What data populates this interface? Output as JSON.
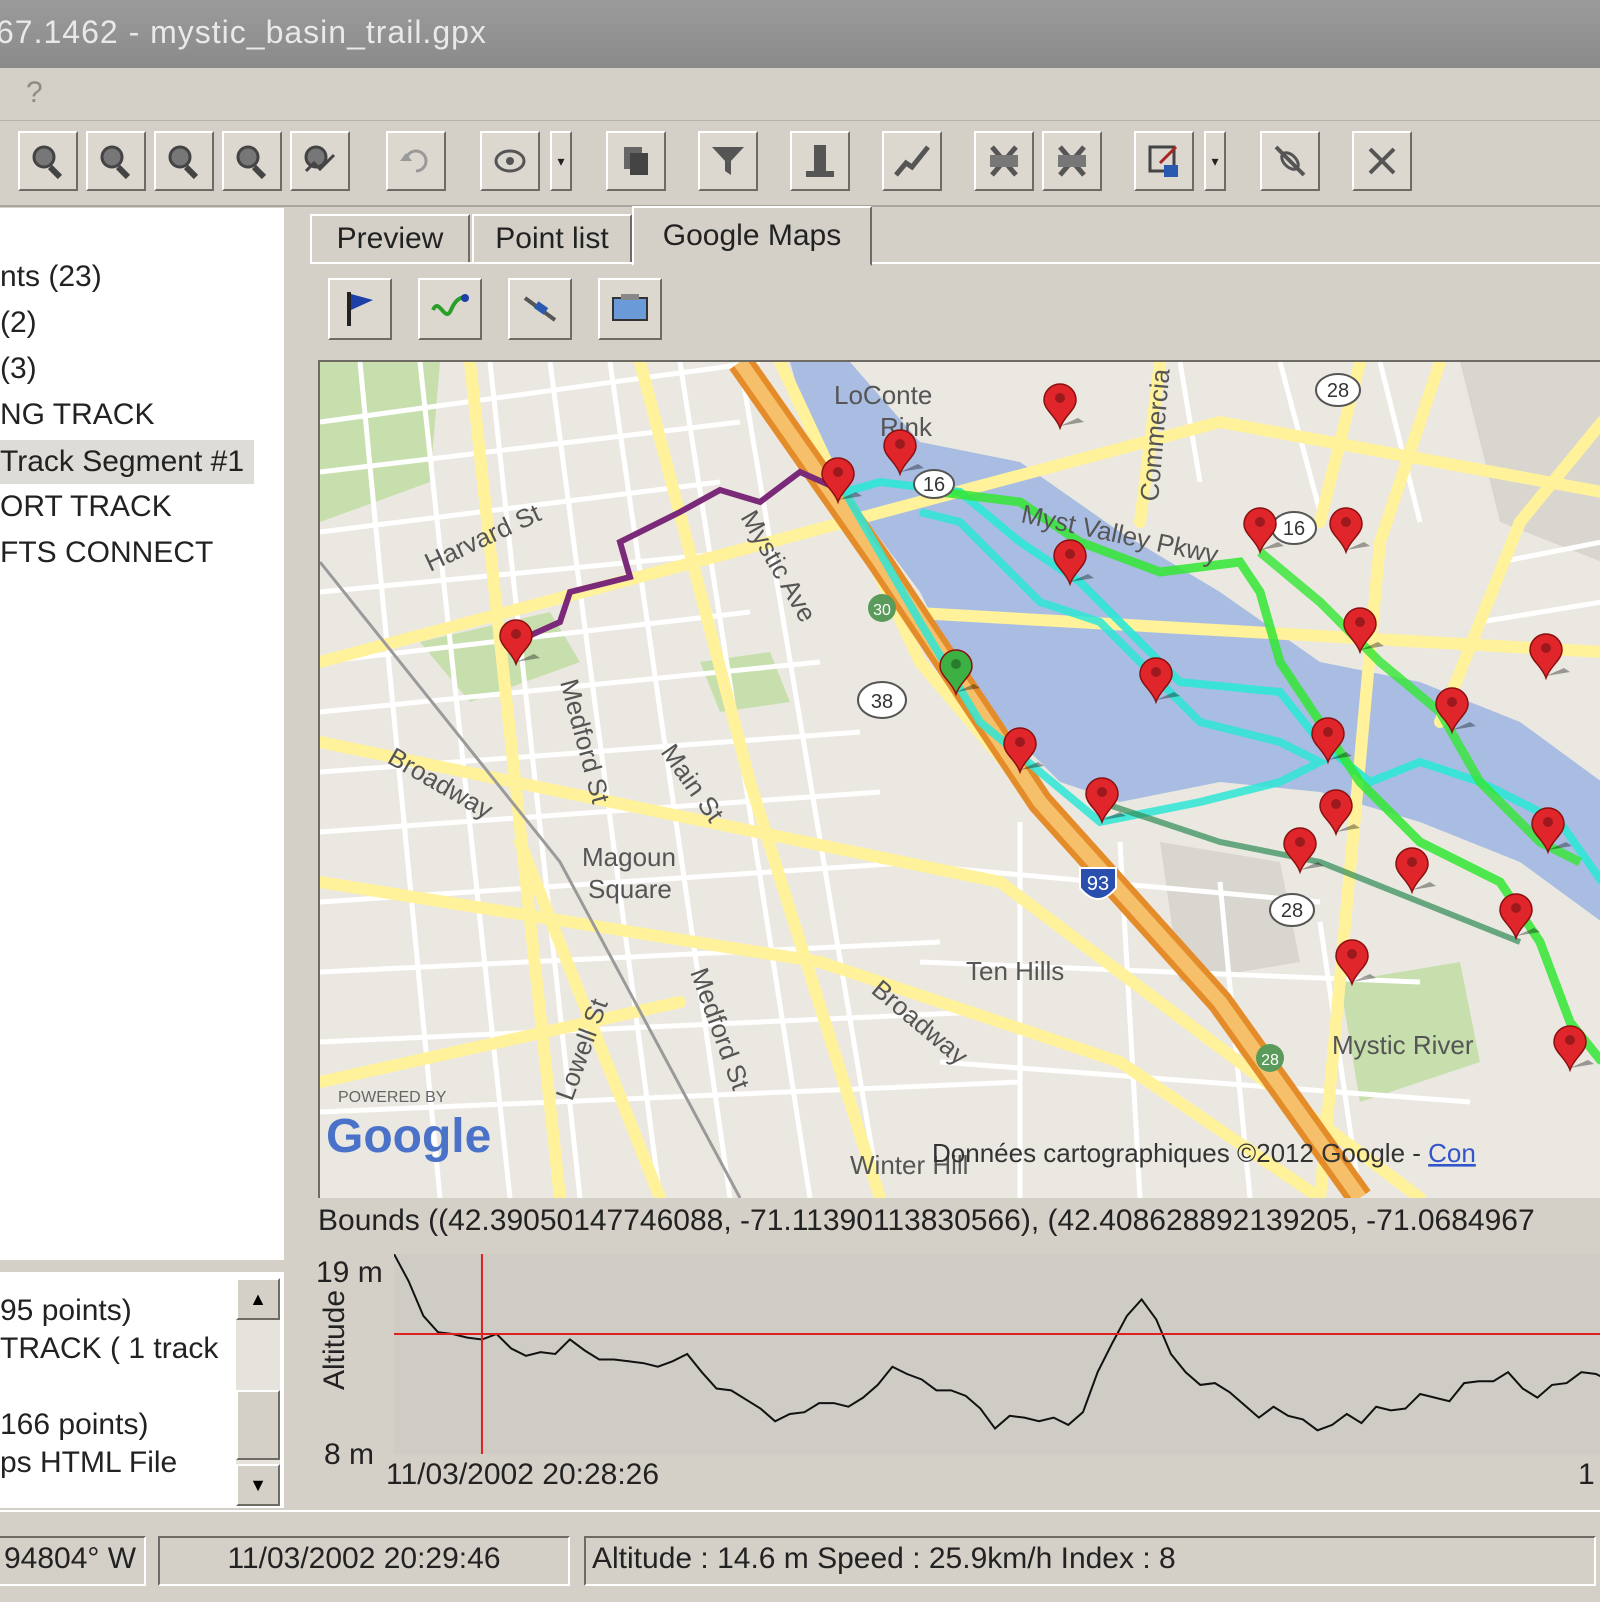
{
  "window": {
    "title": "67.1462 - mystic_basin_trail.gpx"
  },
  "menu": {
    "help_label": "?"
  },
  "toolbar": {
    "buttons": [
      "zoom-in-icon",
      "zoom-out-icon",
      "zoom-fit-icon",
      "zoom-selection-icon",
      "zoom-track-icon",
      "undo-icon",
      "rotate-icon",
      "copy-icon",
      "filter-icon",
      "split-icon",
      "merge-icon",
      "cut-icon",
      "cut-alt-icon",
      "export-icon",
      "link-icon",
      "close-icon"
    ]
  },
  "tree": {
    "items": [
      {
        "label": "nts (23)"
      },
      {
        "label": "(2)"
      },
      {
        "label": "(3)"
      },
      {
        "label": "NG TRACK"
      },
      {
        "label": " Track Segment #1"
      },
      {
        "label": "ORT TRACK"
      },
      {
        "label": "FTS CONNECT"
      }
    ]
  },
  "list": {
    "items": [
      {
        "label": "95 points)"
      },
      {
        "label": "TRACK ( 1 track"
      },
      {
        "label": "166 points)"
      },
      {
        "label": "ps HTML File"
      }
    ]
  },
  "tabs": [
    {
      "label": "Preview"
    },
    {
      "label": "Point list"
    },
    {
      "label": "Google Maps"
    }
  ],
  "map_toolbar": {
    "buttons": [
      "flag-icon",
      "track-icon",
      "route-icon",
      "screen-icon"
    ]
  },
  "map": {
    "labels": {
      "harvard": "Harvard St",
      "mystic_ave": "Mystic Ave",
      "loconte": "LoConte",
      "rink": "Rink",
      "commercial": "Commercia",
      "mystic_valley": "Myst Valley Pkwy",
      "broadway1": "Broadway",
      "broadway2": "Broadway",
      "medford1": "Medford St",
      "medford2": "Medford St",
      "main": "Main St",
      "magoun1": "Magoun",
      "magoun2": "Square",
      "ten_hills": "Ten Hills",
      "lowell": "Lowell St",
      "mystic_river": "Mystic River",
      "winter_hill": "Winter Hill",
      "shield_28a": "28",
      "shield_28b": "28",
      "shield_38": "38",
      "shield_16a": "16",
      "shield_16b": "16",
      "shield_93": "93",
      "shield_30": "30",
      "shield_28c": "28",
      "powered": "POWERED BY",
      "google": "Google",
      "copyright": "Données cartographiques ©2012 Google - ",
      "copyright_link": "Con"
    },
    "colors": {
      "water": "#a9bde3",
      "park": "#c6dfac",
      "road": "#fff6a8",
      "highway": "#f2a94e",
      "track_purple": "#7a2a78",
      "track_cyan": "#2ee6d6",
      "track_green": "#33e633",
      "marker_red": "#e0262a",
      "marker_green": "#3cb043"
    }
  },
  "bounds_text": "Bounds ((42.39050147746088, -71.11390113830566), (42.408628892139205, -71.0684967",
  "elevation": {
    "max_label": "19 m",
    "min_label": "8 m",
    "axis_label": "Altitude",
    "start_time": "11/03/2002 20:28:26",
    "end_time": "1",
    "profile": [
      19,
      17.5,
      15.6,
      14.7,
      14.6,
      14.4,
      14.3,
      14.6,
      13.8,
      13.4,
      13.6,
      13.5,
      14.3,
      13.7,
      13.2,
      13.2,
      13.1,
      13.0,
      12.8,
      13.1,
      13.5,
      12.5,
      11.6,
      11.5,
      11.0,
      10.5,
      9.8,
      10.2,
      10.3,
      10.8,
      10.8,
      10.6,
      11.1,
      11.8,
      12.8,
      12.4,
      12.1,
      11.5,
      11.5,
      11.2,
      10.5,
      9.4,
      10.1,
      10.0,
      9.8,
      10.0,
      9.6,
      10.3,
      12.5,
      14.1,
      15.6,
      16.5,
      15.4,
      13.5,
      12.5,
      11.8,
      11.9,
      11.4,
      10.7,
      10.0,
      10.6,
      10.1,
      9.9,
      9.3,
      9.6,
      10.2,
      9.7,
      10.6,
      10.4,
      10.5,
      11.3,
      11.1,
      10.9,
      11.9,
      12.0,
      12.0,
      12.5,
      11.6,
      11.1,
      11.8,
      11.9,
      12.5,
      12.4,
      12.0,
      12.6,
      11.7
    ],
    "marker_altitude": 14.6,
    "colors": {
      "line": "#111111",
      "marker": "#e02020",
      "plot_bg": "#cfccc5"
    }
  },
  "status": {
    "coords": "94804° W",
    "time": "11/03/2002 20:29:46",
    "info": "Altitude : 14.6 m  Speed : 25.9km/h Index : 8"
  }
}
